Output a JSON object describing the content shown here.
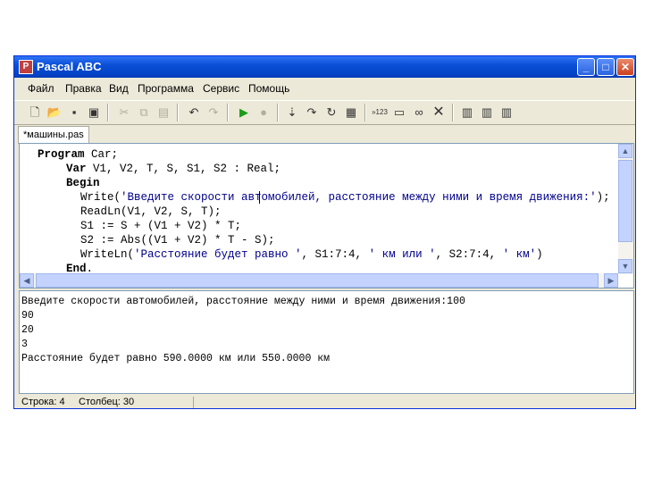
{
  "window": {
    "title": "Pascal ABC",
    "app_icon": "Р"
  },
  "window_buttons": {
    "minimize": "_",
    "maximize": "□",
    "close": "✕"
  },
  "menu": [
    "Файл",
    "Правка",
    "Вид",
    "Программа",
    "Сервис",
    "Помощь"
  ],
  "toolbar_icons": [
    "new-file-icon",
    "open-folder-icon",
    "save-icon",
    "save-all-icon",
    "cut-icon",
    "copy-icon",
    "paste-icon",
    "undo-icon",
    "redo-icon",
    "run-icon",
    "stop-icon",
    "step-into-icon",
    "step-over-icon",
    "step-out-icon",
    "watch-icon",
    "int-icon",
    "window-icon",
    "glasses-icon",
    "close-x-icon",
    "format-icon",
    "compile-icon",
    "build-icon"
  ],
  "tab": {
    "label": "*машины.pas"
  },
  "code": [
    {
      "kw": "Program",
      "rest": " Car;"
    },
    {
      "kw": "Var",
      "rest": " V1, V2, T, S, S1, S2 : Real;"
    },
    {
      "kw": "Begin",
      "rest": ""
    },
    {
      "fn": "Write(",
      "str": "'Введите скорости автомобилей, расстояние между ними и время движения:'",
      "tail": ");"
    },
    {
      "fn": "ReadLn(V1, V2, S, T);"
    },
    {
      "fn": "S1 := S + (V1 + V2) * T;"
    },
    {
      "fn": "S2 := Abs((V1 + V2) * T - S);"
    },
    {
      "fn": "WriteLn(",
      "str": "'Расстояние будет равно '",
      "mid": ", S1:7:4, ",
      "str2": "' км или '",
      "mid2": ", S2:7:4, ",
      "str3": "' км'",
      "tail": ")"
    },
    {
      "kw": "End",
      "rest": "."
    }
  ],
  "output": [
    "Введите скорости автомобилей, расстояние между ними и время движения:100",
    "90",
    "20",
    "3",
    "Расстояние будет равно 590.0000 км или 550.0000 км"
  ],
  "status": {
    "line": "Строка: 4",
    "column": "Столбец: 30"
  }
}
